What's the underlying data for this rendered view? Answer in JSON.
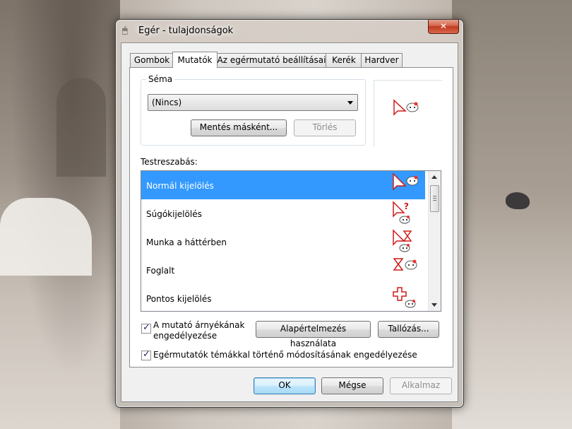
{
  "window": {
    "title": "Egér - tulajdonságok",
    "close_glyph": "✕"
  },
  "tabs": [
    "Gombok",
    "Mutatók",
    "Az egérmutató beállításai",
    "Kerék",
    "Hardver"
  ],
  "active_tab": "Mutatók",
  "scheme": {
    "legend": "Séma",
    "selected": "(Nincs)",
    "save_as": "Mentés másként...",
    "delete": "Törlés"
  },
  "customize": {
    "label": "Testreszabás:",
    "items": [
      {
        "label": "Normál kijelölés",
        "icon": "arrow-cursor-icon",
        "selected": true
      },
      {
        "label": "Súgókijelölés",
        "icon": "help-cursor-icon",
        "selected": false
      },
      {
        "label": "Munka a háttérben",
        "icon": "working-cursor-icon",
        "selected": false
      },
      {
        "label": "Foglalt",
        "icon": "busy-cursor-icon",
        "selected": false
      },
      {
        "label": "Pontos kijelölés",
        "icon": "precision-cursor-icon",
        "selected": false
      }
    ]
  },
  "options": {
    "shadow_line1": "A mutató árnyékának",
    "shadow_line2": "engedélyezése",
    "shadow_checked": true,
    "use_default": "Alapértelmezés használata",
    "browse": "Tallózás...",
    "themes_label": "Egérmutatók témákkal történő módosításának engedélyezése",
    "themes_checked": true
  },
  "footer": {
    "ok": "OK",
    "cancel": "Mégse",
    "apply": "Alkalmaz"
  },
  "colors": {
    "selection": "#3399ff",
    "cursor_red": "#d01a1a"
  }
}
